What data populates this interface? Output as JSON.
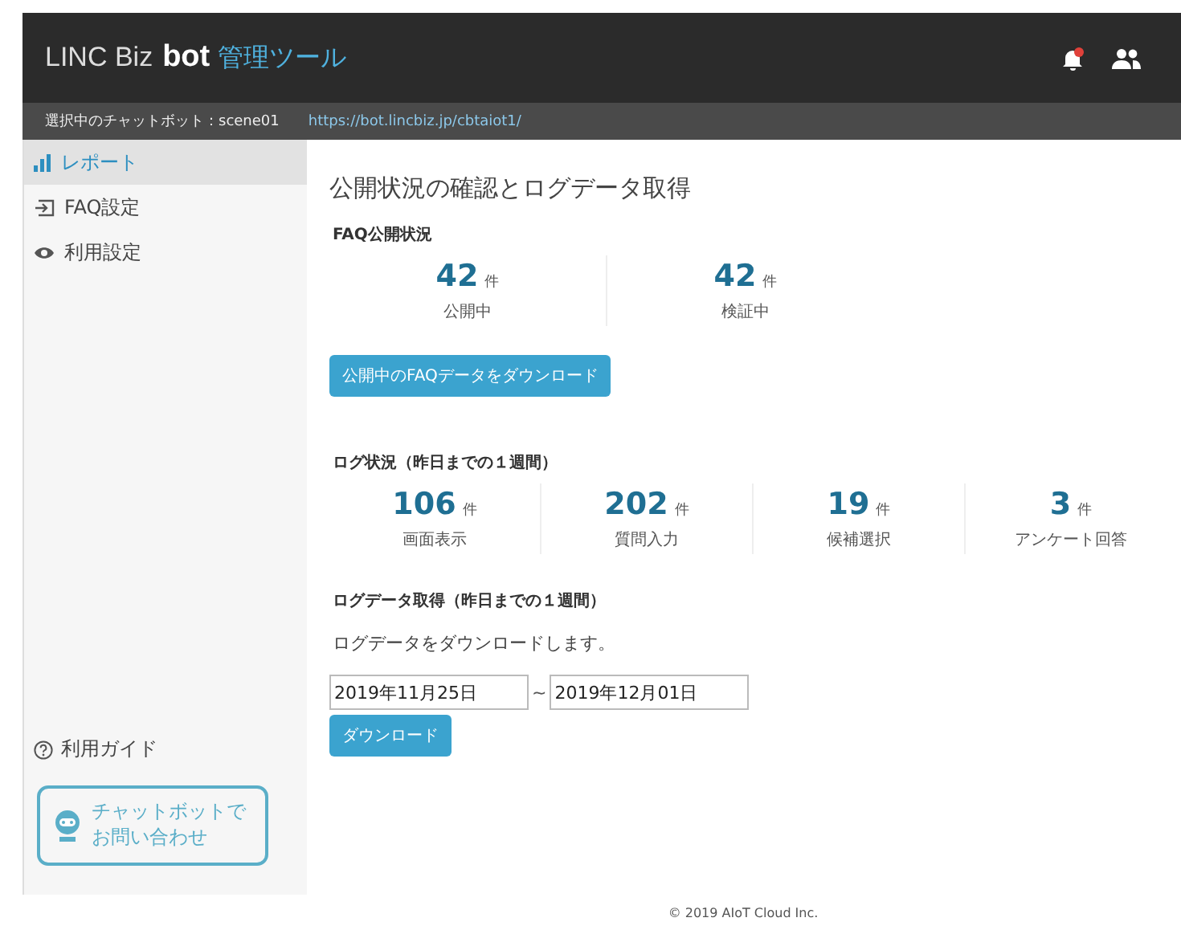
{
  "header": {
    "brand": "LINC Biz",
    "brand_bold": "bot",
    "brand_accent": "管理ツール",
    "notification": true
  },
  "bot_bar": {
    "label": "選択中のチャットボット：scene01",
    "url": "https://bot.lincbiz.jp/cbtaiot1/"
  },
  "sidebar": {
    "items": [
      {
        "label": "レポート",
        "selected": true
      },
      {
        "label": "FAQ設定",
        "selected": false
      },
      {
        "label": "利用設定",
        "selected": false
      }
    ],
    "guide": "利用ガイド",
    "contact_lines": [
      "チャットボットで",
      "お問い合わせ"
    ]
  },
  "title": "公開状況の確認とログデータ取得",
  "faq_status": {
    "heading": "FAQ公開状況",
    "stats": [
      {
        "value": "42",
        "unit": "件",
        "label": "公開中"
      },
      {
        "value": "42",
        "unit": "件",
        "label": "検証中"
      }
    ],
    "button": "公開中のFAQデータをダウンロード"
  },
  "log_status": {
    "heading": "ログ状況（昨日までの１週間）",
    "stats": [
      {
        "value": "106",
        "unit": "件",
        "label": "画面表示"
      },
      {
        "value": "202",
        "unit": "件",
        "label": "質問入力"
      },
      {
        "value": "19",
        "unit": "件",
        "label": "候補選択"
      },
      {
        "value": "3",
        "unit": "件",
        "label": "アンケート回答"
      }
    ]
  },
  "log_download": {
    "heading": "ログデータ取得（昨日までの１週間）",
    "description": "ログデータをダウンロードします。",
    "date_from": "2019年11月25日",
    "separator": "~",
    "date_to": "2019年12月01日",
    "button": "ダウンロード"
  },
  "footer": "© 2019 AIoT Cloud Inc."
}
